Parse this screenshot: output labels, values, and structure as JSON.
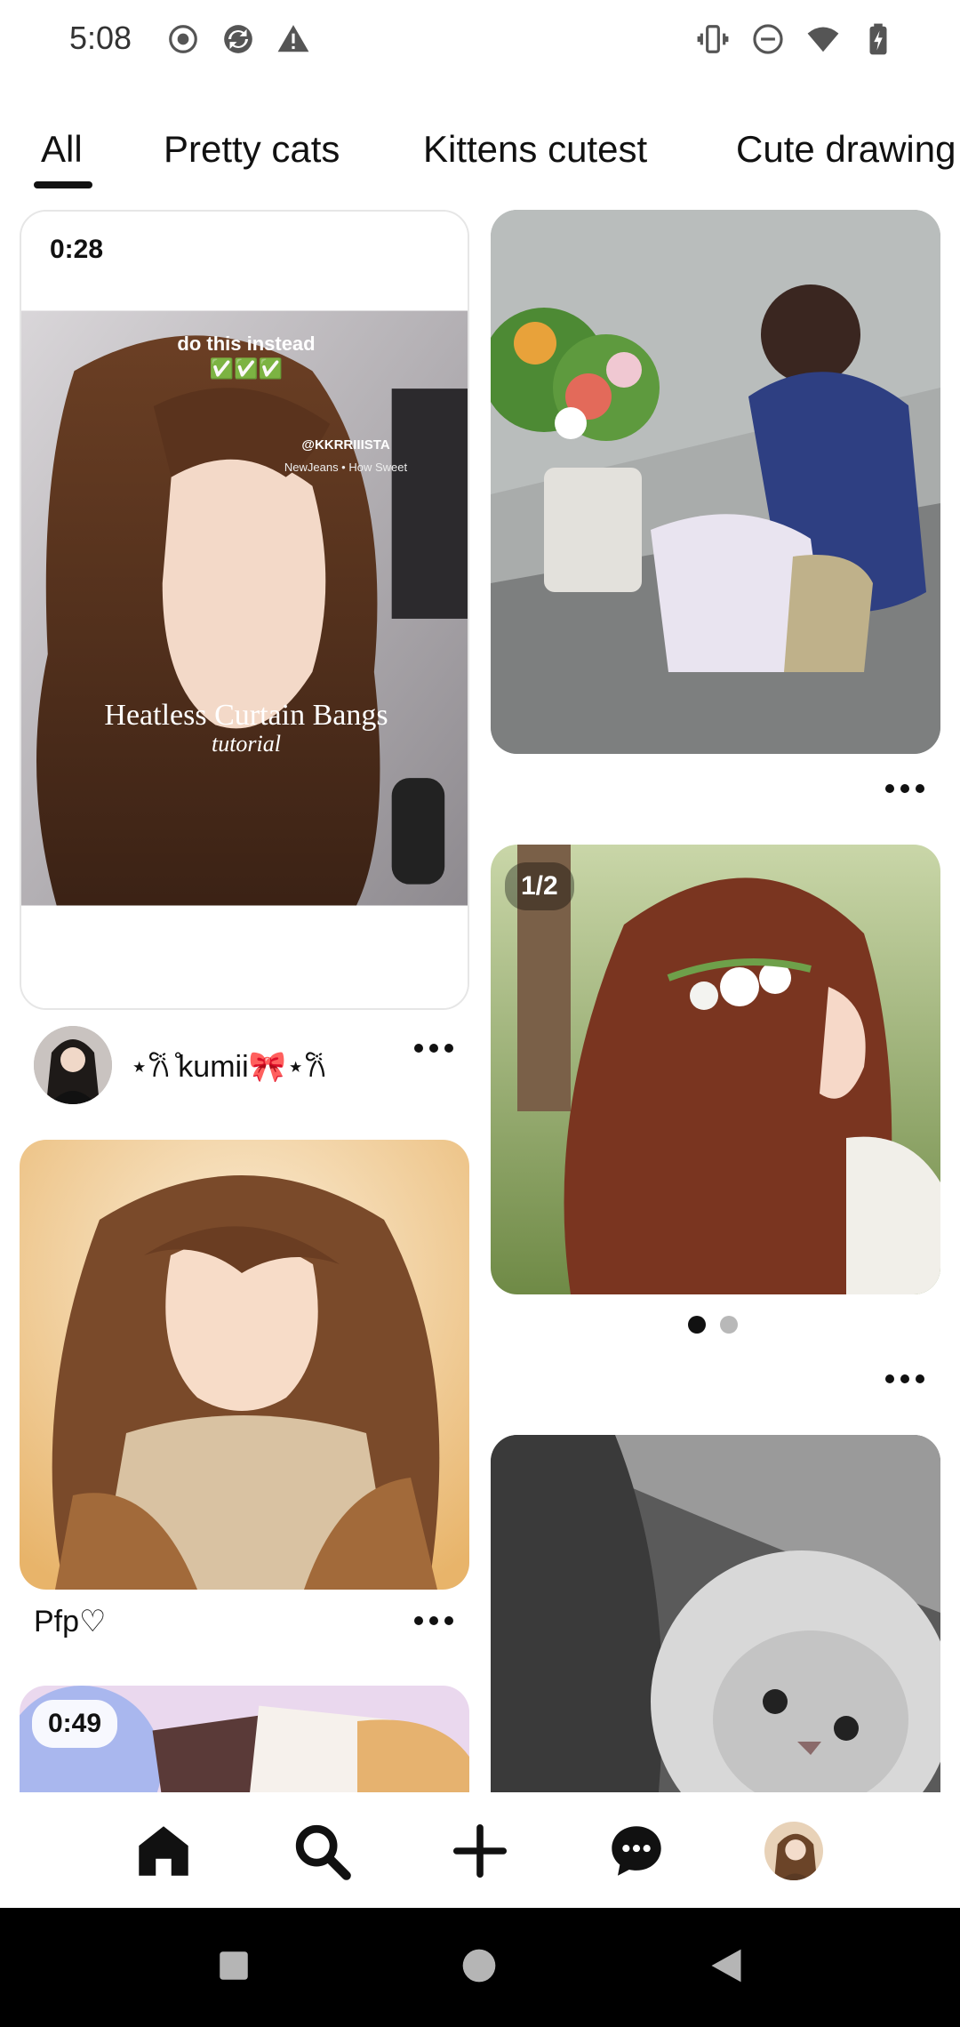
{
  "status_bar": {
    "time": "5:08",
    "left_icons": [
      "record-icon",
      "app-sync-icon",
      "warning-icon"
    ],
    "right_icons": [
      "vibrate-icon",
      "do-not-disturb-icon",
      "wifi-icon",
      "battery-charging-icon"
    ]
  },
  "tabs": [
    {
      "label": "All",
      "selected": true
    },
    {
      "label": "Pretty cats",
      "selected": false
    },
    {
      "label": "Kittens cutest",
      "selected": false
    },
    {
      "label": "Cute drawing",
      "selected": false
    }
  ],
  "pins": [
    {
      "id": "pin-curtain-bangs",
      "type": "video",
      "duration": "0:28",
      "overlay_texts": [
        "do this instead",
        "✅✅✅",
        "@KKRRIIISTA",
        "NewJeans • How Sweet",
        "Heatless Curtain Bangs",
        "tutorial"
      ],
      "creator": "⋆𐙚 ̊kumii🎀⋆𐙚"
    },
    {
      "id": "pin-flower-girl",
      "type": "image",
      "description": "anime girl crouching by flower buckets"
    },
    {
      "id": "pin-flower-hair",
      "type": "carousel",
      "counter": "1/2",
      "page_count": 2,
      "current_page": 1
    },
    {
      "id": "pin-pfp",
      "type": "image",
      "title": "Pfp♡"
    },
    {
      "id": "pin-cat",
      "type": "image"
    },
    {
      "id": "pin-video-2",
      "type": "video",
      "duration": "0:49"
    }
  ],
  "bottom_nav": [
    "home-icon",
    "search-icon",
    "create-icon",
    "messages-icon",
    "profile-avatar"
  ],
  "colors": {
    "text": "#111111",
    "background": "#ffffff",
    "dot_active": "#111111",
    "dot_inactive": "#b8b8b8",
    "system_nav": "#000000"
  }
}
